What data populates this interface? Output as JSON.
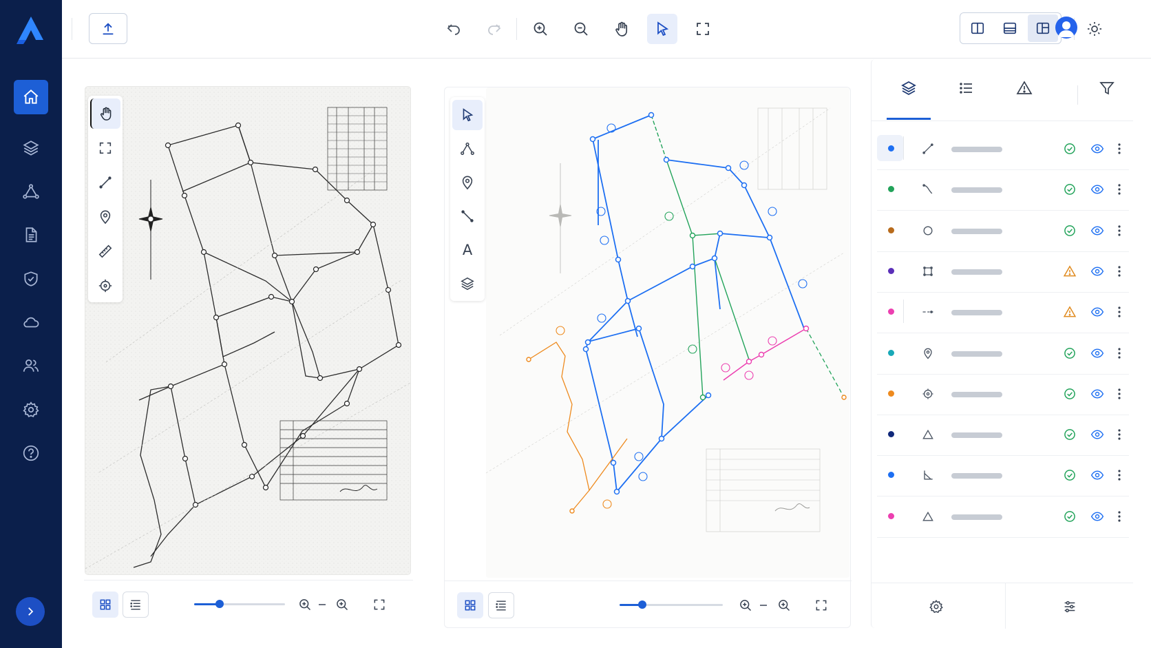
{
  "colors": {
    "sidebar_bg": "#0b1f4b",
    "accent": "#1d5fd6",
    "ok": "#22a35a",
    "warn": "#e08a1e"
  },
  "sidebar": {
    "items": [
      {
        "icon": "home-icon",
        "active": true
      },
      {
        "icon": "layers-icon"
      },
      {
        "icon": "topology-icon"
      },
      {
        "icon": "document-icon"
      },
      {
        "icon": "shield-check-icon"
      },
      {
        "icon": "cloud-icon"
      },
      {
        "icon": "users-icon"
      },
      {
        "icon": "settings-icon"
      },
      {
        "icon": "help-icon"
      }
    ],
    "expand_icon": "chevron-right-icon"
  },
  "toolbar": {
    "tools": [
      "upload-icon",
      "undo-icon",
      "redo-icon",
      "zoom-in-icon",
      "zoom-out-icon",
      "pan-hand-icon",
      "select-pointer-icon",
      "fit-frame-icon"
    ],
    "active_tool": "select-pointer-icon",
    "layouts": [
      "split-vertical-icon",
      "split-horizontal-icon",
      "split-compare-icon"
    ],
    "active_layout": "split-compare-icon"
  },
  "left_viewer": {
    "tools": [
      "pan-hand-icon",
      "fit-frame-icon",
      "line-icon",
      "pin-icon",
      "ruler-icon",
      "crosshair-icon"
    ],
    "active_tool": "pan-hand-icon",
    "zoom_fraction": 0.28
  },
  "right_viewer": {
    "tools": [
      "select-pointer-icon",
      "vertex-icon",
      "pin-icon",
      "segment-icon",
      "text-icon",
      "layers-icon"
    ],
    "active_tool": "select-pointer-icon",
    "text_tool_label": "A",
    "zoom_fraction": 0.22
  },
  "layers_panel": {
    "tabs": [
      "layers-icon",
      "list-icon",
      "warning-icon",
      "filter-icon"
    ],
    "active_tab": "layers-icon",
    "layers": [
      {
        "color": "#1d6ff2",
        "icon": "line-icon",
        "status": "ok"
      },
      {
        "color": "#22a35a",
        "icon": "curve-icon",
        "status": "ok"
      },
      {
        "color": "#b86b1c",
        "icon": "circle-icon",
        "status": "ok"
      },
      {
        "color": "#5b2fb8",
        "icon": "square-icon",
        "status": "warning"
      },
      {
        "color": "#ec3fb0",
        "icon": "dashed-line-icon",
        "status": "warning"
      },
      {
        "color": "#19a9b8",
        "icon": "pin-icon",
        "status": "ok"
      },
      {
        "color": "#ee8a1e",
        "icon": "crosshair-icon",
        "status": "ok"
      },
      {
        "color": "#10287a",
        "icon": "triangle-icon",
        "status": "ok"
      },
      {
        "color": "#1d6ff2",
        "icon": "angle-icon",
        "status": "ok"
      },
      {
        "color": "#ec3fb0",
        "icon": "triangle-icon",
        "status": "ok"
      }
    ],
    "footer": [
      "settings-icon",
      "sliders-icon"
    ]
  }
}
